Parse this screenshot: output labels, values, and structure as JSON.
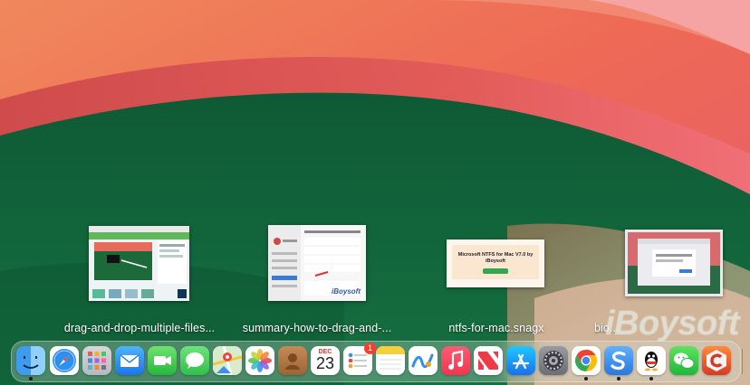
{
  "desktop": {
    "files": [
      {
        "name": "drag-and-drop-multiple-files...",
        "thumb": "screenshot-desktop-editor"
      },
      {
        "name": "summary-how-to-drag-and-...",
        "thumb": "screenshot-system-settings",
        "thumb_text": "iBoysoft"
      },
      {
        "name": "ntfs-for-mac.snagx",
        "thumb": "screenshot-ntfs-banner",
        "thumb_text": "Microsoft NTFS for Mac V7.0 by iBoysoft"
      },
      {
        "name": "bio...",
        "thumb": "screenshot-dialog"
      }
    ],
    "watermark": "iBoysoft"
  },
  "dock": {
    "apps": [
      {
        "name": "Finder",
        "icon": "finder-icon",
        "running": true
      },
      {
        "name": "Safari",
        "icon": "safari-icon",
        "running": false
      },
      {
        "name": "Launchpad",
        "icon": "launchpad-icon",
        "running": false
      },
      {
        "name": "Mail",
        "icon": "mail-icon",
        "running": false
      },
      {
        "name": "FaceTime",
        "icon": "facetime-icon",
        "running": false
      },
      {
        "name": "Messages",
        "icon": "messages-icon",
        "running": false
      },
      {
        "name": "Maps",
        "icon": "maps-icon",
        "running": false
      },
      {
        "name": "Photos",
        "icon": "photos-icon",
        "running": false
      },
      {
        "name": "Contacts",
        "icon": "contacts-icon",
        "running": false
      },
      {
        "name": "Calendar",
        "icon": "calendar-icon",
        "running": false,
        "month": "DEC",
        "day": "23"
      },
      {
        "name": "Reminders",
        "icon": "reminders-icon",
        "running": false,
        "badge": "1"
      },
      {
        "name": "Notes",
        "icon": "notes-icon",
        "running": false
      },
      {
        "name": "Freeform",
        "icon": "freeform-icon",
        "running": false
      },
      {
        "name": "Music",
        "icon": "music-icon",
        "running": false
      },
      {
        "name": "News",
        "icon": "news-icon",
        "running": false
      },
      {
        "name": "App Store",
        "icon": "app-store-icon",
        "running": false
      },
      {
        "name": "System Settings",
        "icon": "system-settings-icon",
        "running": false
      },
      {
        "name": "Chrome",
        "icon": "chrome-icon",
        "running": true
      },
      {
        "name": "Snagit",
        "icon": "snagit-icon",
        "running": true
      },
      {
        "name": "QQ",
        "icon": "qq-icon",
        "running": true
      },
      {
        "name": "WeChat",
        "icon": "wechat-icon",
        "running": false
      },
      {
        "name": "CleanMyMac",
        "icon": "cleanmymac-icon",
        "running": false
      }
    ]
  }
}
